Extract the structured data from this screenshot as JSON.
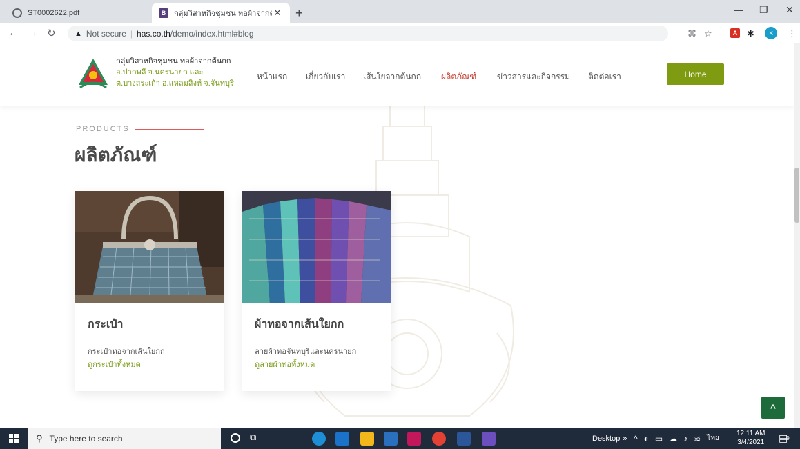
{
  "browser": {
    "tabs": [
      {
        "title": "ST0002622.pdf",
        "active": false
      },
      {
        "title": "กลุ่มวิสาหกิจชุมชน ทอผ้าจากต้นกก",
        "active": true,
        "favicon_letter": "B"
      }
    ],
    "new_tab_label": "+",
    "url_warning": "Not secure",
    "url_host": "has.co.th",
    "url_path": "/demo/index.html#blog",
    "profile_initial": "k"
  },
  "site": {
    "brand_line1": "กลุ่มวิสาหกิจชุมชน ทอผ้าจากต้นกก",
    "brand_line2": "อ.ปากพลี จ.นครนายก และ",
    "brand_line3": "ต.บางสระเก้า อ.แหลมสิงห์ จ.จันทบุรี",
    "nav": [
      "หน้าแรก",
      "เกี่ยวกับเรา",
      "เส้นใยจากต้นกก",
      "ผลิตภัณฑ์",
      "ข่าวสารและกิจกรรม",
      "ติดต่อเรา"
    ],
    "nav_active_index": 3,
    "home_button": "Home",
    "section_label": "PRODUCTS",
    "section_title": "ผลิตภัณฑ์",
    "products": [
      {
        "title": "กระเป๋า",
        "description": "กระเป๋าทอจากเส้นใยกก",
        "link": "ดูกระเป๋าทั้งหมด"
      },
      {
        "title": "ผ้าทอจากเส้นใยกก",
        "description": "ลายผ้าทอจันทบุรีและนครนายก",
        "link": "ดูลายผ้าทอทั้งหมด"
      }
    ],
    "back_to_top": "^"
  },
  "taskbar": {
    "search_placeholder": "Type here to search",
    "desktop_label": "Desktop",
    "language": "ไทย",
    "time": "12:11 AM",
    "date": "3/4/2021",
    "notification_count": "9"
  },
  "colors": {
    "accent_green": "#7f9b12",
    "nav_active": "#c0392b",
    "back_top": "#1d6b3a"
  }
}
